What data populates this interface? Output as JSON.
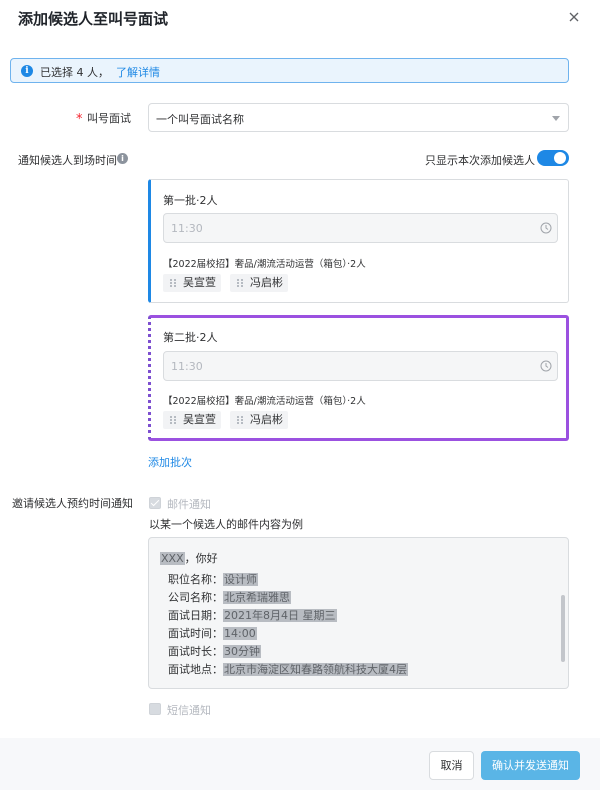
{
  "dialog": {
    "title": "添加候选人至叫号面试"
  },
  "info_bar": {
    "icon": "info-icon",
    "text": "已选择 4 人，",
    "link": "了解详情"
  },
  "queue_field": {
    "label": "叫号面试",
    "value": "一个叫号面试名称"
  },
  "notify_time": {
    "label": "通知候选人到场时间",
    "toggle_label": "只显示本次添加候选人",
    "toggle_on": true
  },
  "batches": [
    {
      "title": "第一批·2人",
      "time_placeholder": "11:30",
      "job": "【2022届校招】奢品/潮流活动运营（箱包）·2人",
      "candidates": [
        "吴宣萱",
        "冯启彬"
      ]
    },
    {
      "title": "第二批·2人",
      "time_placeholder": "11:30",
      "job": "【2022届校招】奢品/潮流活动运营（箱包）·2人",
      "candidates": [
        "吴宣萱",
        "冯启彬"
      ]
    }
  ],
  "add_batch": "添加批次",
  "invite": {
    "label": "邀请候选人预约时间通知",
    "email_option": "邮件通知",
    "email_checked": true,
    "example_label": "以某一个候选人的邮件内容为例",
    "greeting_name": "XXX",
    "greeting_rest": "，你好",
    "rows": [
      {
        "label": "职位名称：",
        "value": "设计师"
      },
      {
        "label": "公司名称：",
        "value": "北京希瑞雅思"
      },
      {
        "label": "面试日期：",
        "value": "2021年8月4日 星期三"
      },
      {
        "label": "面试时间：",
        "value": "14:00"
      },
      {
        "label": "面试时长：",
        "value": "30分钟"
      },
      {
        "label": "面试地点：",
        "value": "北京市海淀区知春路领航科技大厦4层"
      }
    ],
    "sms_option": "短信通知",
    "sms_checked": false
  },
  "footer": {
    "cancel": "取消",
    "confirm": "确认并发送通知"
  },
  "colors": {
    "accent": "#1e88e5",
    "highlight_border": "#9b51e0",
    "required": "#f5222d",
    "confirm_button": "#5ab5e6"
  }
}
